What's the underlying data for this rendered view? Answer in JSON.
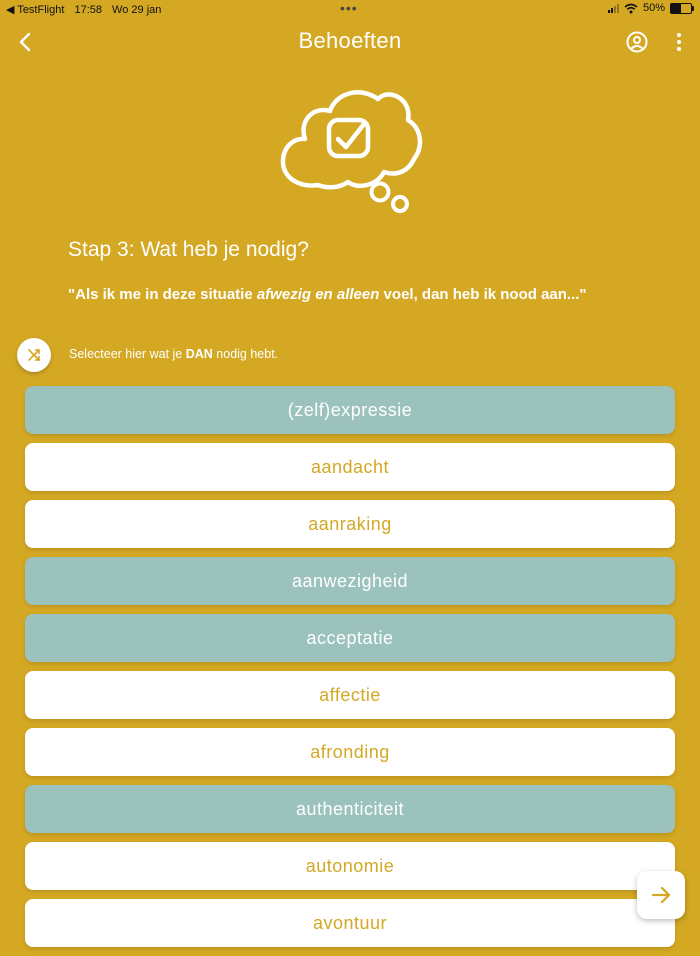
{
  "status_bar": {
    "back_app": "◀ TestFlight",
    "time": "17:58",
    "date": "Wo 29 jan",
    "dots": "•••",
    "battery": "50%",
    "battery_level": 0.5
  },
  "header": {
    "title": "Behoeften"
  },
  "step": {
    "title": "Stap 3: Wat heb je nodig?",
    "quote_prefix": "\"Als ik me in deze situatie ",
    "quote_emphasis": "afwezig en alleen",
    "quote_suffix": " voel, dan heb ik nood aan...\""
  },
  "hint": {
    "prefix": "Selecteer hier wat je ",
    "bold": "DAN",
    "suffix": " nodig hebt."
  },
  "needs": [
    {
      "label": "(zelf)expressie",
      "selected": true
    },
    {
      "label": "aandacht",
      "selected": false
    },
    {
      "label": "aanraking",
      "selected": false
    },
    {
      "label": "aanwezigheid",
      "selected": true
    },
    {
      "label": "acceptatie",
      "selected": true
    },
    {
      "label": "affectie",
      "selected": false
    },
    {
      "label": "afronding",
      "selected": false
    },
    {
      "label": "authenticiteit",
      "selected": true
    },
    {
      "label": "autonomie",
      "selected": false
    },
    {
      "label": "avontuur",
      "selected": false
    }
  ],
  "colors": {
    "background": "#D4A823",
    "selected": "#9CC2BD",
    "unselected": "#FFFFFF",
    "accent_text": "#D4A823"
  },
  "icons": {
    "back": "chevron-left-icon",
    "profile": "user-circle-icon",
    "more": "more-vertical-icon",
    "hero": "thought-cloud-check-icon",
    "hint": "shuffle-icon",
    "next": "arrow-right-icon"
  }
}
